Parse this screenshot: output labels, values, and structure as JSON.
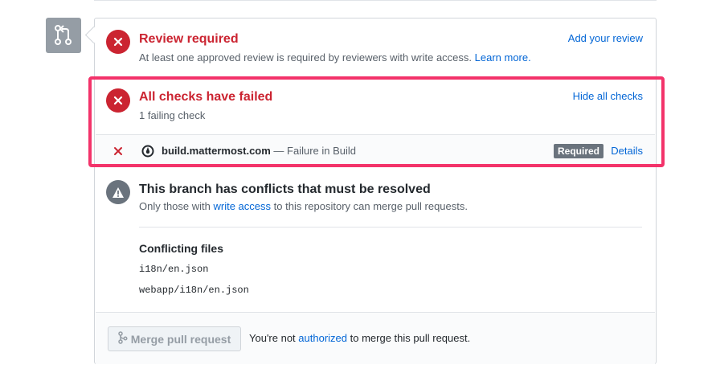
{
  "review": {
    "title": "Review required",
    "description": "At least one approved review is required by reviewers with write access.",
    "learn_more": "Learn more.",
    "action": "Add your review"
  },
  "checks": {
    "title": "All checks have failed",
    "subtitle": "1 failing check",
    "action": "Hide all checks",
    "items": [
      {
        "name": "build.mattermost.com",
        "status": "— Failure in Build",
        "badge": "Required",
        "details": "Details"
      }
    ]
  },
  "conflicts": {
    "title": "This branch has conflicts that must be resolved",
    "desc_prefix": "Only those with",
    "desc_link": "write access",
    "desc_suffix": "to this repository can merge pull requests.",
    "files_heading": "Conflicting files",
    "files": [
      "i18n/en.json",
      "webapp/i18n/en.json"
    ]
  },
  "merge": {
    "button_label": "Merge pull request",
    "note_prefix": "You're not",
    "note_link": "authorized",
    "note_suffix": "to merge this pull request."
  },
  "colors": {
    "error": "#cb2431",
    "link": "#0366d6",
    "highlight": "#f3336a",
    "muted_icon": "#959da5"
  }
}
